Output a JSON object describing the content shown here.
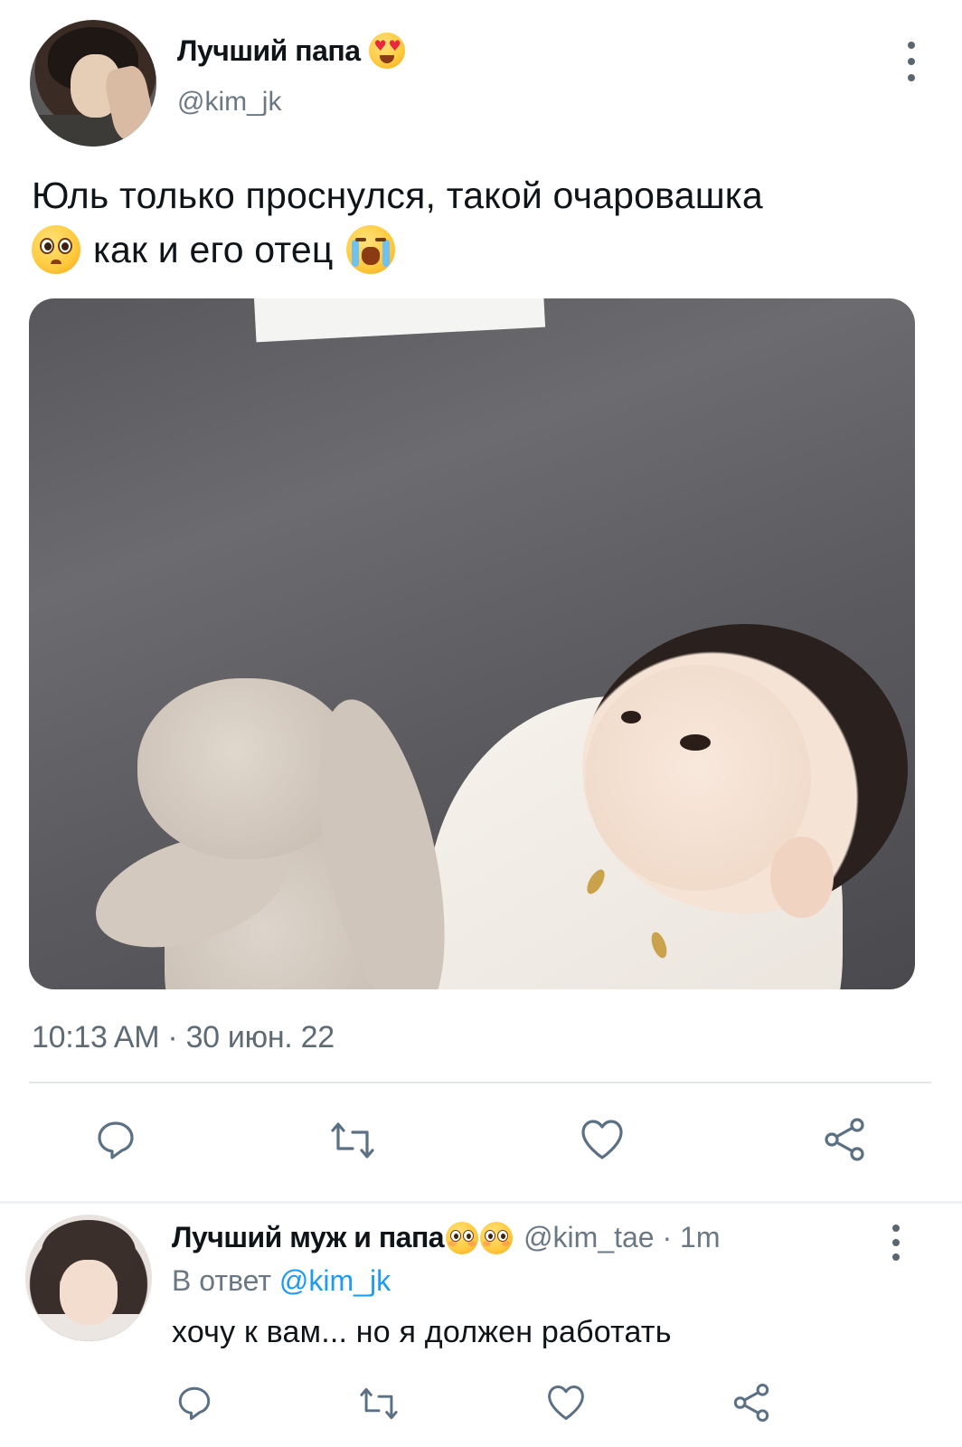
{
  "main_tweet": {
    "display_name": "Лучший папа",
    "handle": "@kim_jk",
    "text_line1": "Юль только проснулся, такой очаровашка",
    "text_line2": "как и его отец",
    "timestamp": "10:13 AM · 30 июн. 22",
    "name_emoji": "heart-eyes-emoji",
    "line2_emojis": [
      "pleading-face-emoji",
      "loudly-crying-face-emoji"
    ]
  },
  "reply": {
    "display_name": "Лучший муж и папа",
    "name_emojis": [
      "flushed-face-emoji",
      "flushed-face-emoji"
    ],
    "meta": "@kim_tae · 1m",
    "reply_prefix": "В ответ",
    "reply_handle": "@kim_jk",
    "text": "хочу к вам... но я должен работать"
  },
  "icons": {
    "reply": "reply-icon",
    "retweet": "retweet-icon",
    "like": "like-icon",
    "share": "share-icon",
    "more": "more-vertical-icon"
  },
  "colors": {
    "text": "#0f1419",
    "secondary": "#6b7884",
    "link": "#1d9bf0",
    "icon": "#5b7083"
  }
}
